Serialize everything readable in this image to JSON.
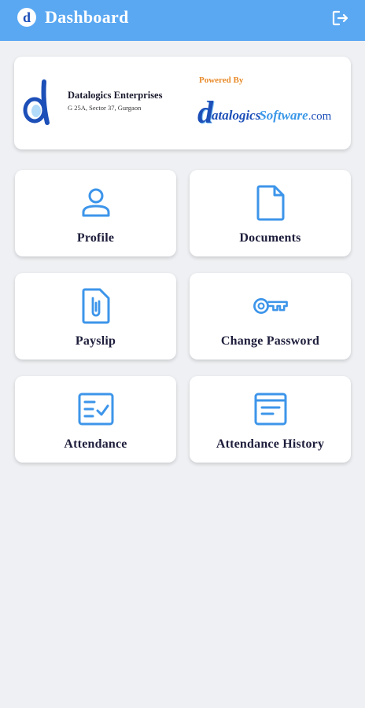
{
  "appbar": {
    "logo_letter": "d",
    "title": "Dashboard",
    "logout_icon": "logout-icon"
  },
  "company": {
    "name": "Datalogics Enterprises",
    "address": "G 25A, Sector 37, Gurgaon",
    "powered_by": "Powered By",
    "brand_d": "d",
    "brand_atalogics": "atalogics",
    "brand_software": "Software",
    "brand_com": ".com"
  },
  "tiles": [
    {
      "label": "Profile",
      "icon": "person-icon"
    },
    {
      "label": "Documents",
      "icon": "document-icon"
    },
    {
      "label": "Payslip",
      "icon": "attachment-file-icon"
    },
    {
      "label": "Change Password",
      "icon": "key-icon"
    },
    {
      "label": "Attendance",
      "icon": "checklist-icon"
    },
    {
      "label": "Attendance History",
      "icon": "history-list-icon"
    }
  ],
  "colors": {
    "appbar": "#5aa8f2",
    "icon_blue": "#3d95ea",
    "background": "#eef0f3",
    "label_text": "#1e1e3c",
    "powered_by": "#e88a2a",
    "brand_blue": "#1d4fb8"
  }
}
